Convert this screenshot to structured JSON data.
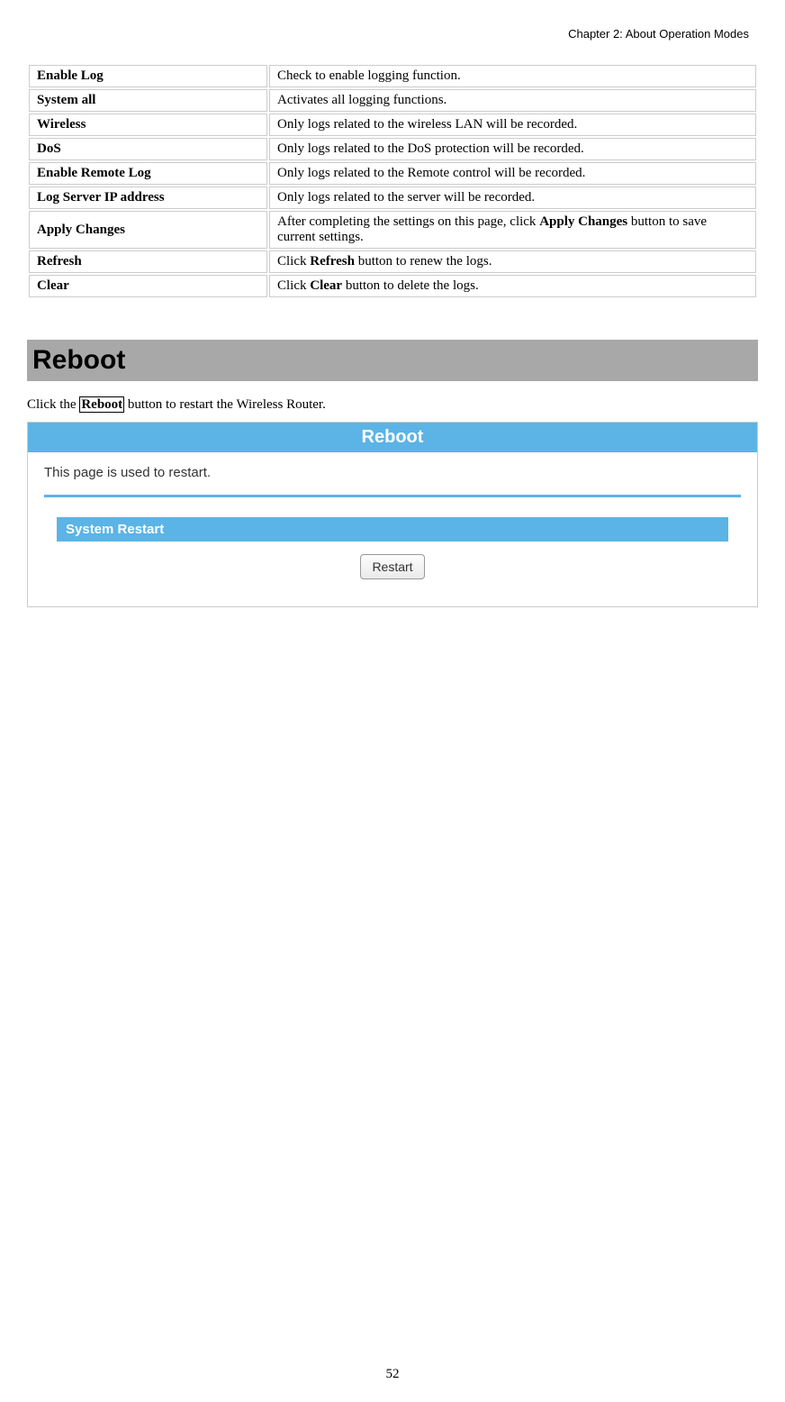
{
  "header": {
    "chapter": "Chapter 2: About Operation Modes"
  },
  "settings": {
    "rows": [
      {
        "label": "Enable Log",
        "desc": "Check to enable logging function."
      },
      {
        "label": "System all",
        "desc": "Activates all logging functions."
      },
      {
        "label": "Wireless",
        "desc": "Only logs related to the wireless LAN will be recorded."
      },
      {
        "label": "DoS",
        "desc": "Only logs related to the DoS protection will be recorded."
      },
      {
        "label": "Enable Remote Log",
        "desc": "Only logs related to the Remote control will be recorded."
      },
      {
        "label": "Log Server IP address",
        "desc": "Only logs related to the server will be recorded."
      }
    ],
    "apply": {
      "label": "Apply Changes",
      "desc_part1": "After completing the settings on this page, click ",
      "desc_bold": "Apply Changes",
      "desc_part2": " button to save current settings."
    },
    "refresh": {
      "label": "Refresh",
      "desc_part1": "Click ",
      "desc_bold": "Refresh",
      "desc_part2": " button to renew the logs."
    },
    "clear": {
      "label": "Clear",
      "desc_part1": "Click ",
      "desc_bold": "Clear",
      "desc_part2": " button to delete the logs."
    }
  },
  "reboot": {
    "heading": "Reboot",
    "desc_part1": "Click the ",
    "desc_boxed": "Reboot",
    "desc_part2": " button to restart the Wireless Router.",
    "panel_title": "Reboot",
    "panel_body": "This page is used to restart.",
    "system_restart_label": "System Restart",
    "restart_button": "Restart"
  },
  "page_number": "52"
}
